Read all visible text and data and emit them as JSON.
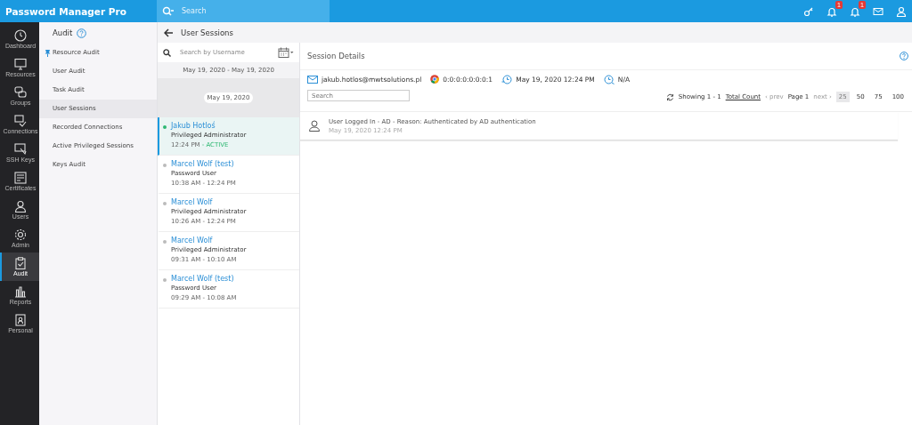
{
  "app": {
    "logo": "Password Manager Pro",
    "search_placeholder": "Search",
    "header_icons": [
      {
        "kind": "key"
      },
      {
        "kind": "bell-star",
        "badge": "1"
      },
      {
        "kind": "bell",
        "badge": "1"
      },
      {
        "kind": "mail"
      },
      {
        "kind": "user"
      }
    ]
  },
  "rail": [
    {
      "label": "Dashboard",
      "selected": false
    },
    {
      "label": "Resources",
      "selected": false
    },
    {
      "label": "Groups",
      "selected": false
    },
    {
      "label": "Connections",
      "selected": false
    },
    {
      "label": "SSH Keys",
      "selected": false
    },
    {
      "label": "Certificates",
      "selected": false
    },
    {
      "label": "Users",
      "selected": false
    },
    {
      "label": "Admin",
      "selected": false
    },
    {
      "label": "Audit",
      "selected": true
    },
    {
      "label": "Reports",
      "selected": false
    },
    {
      "label": "Personal",
      "selected": false
    }
  ],
  "audit_menu": {
    "title": "Audit",
    "items": [
      {
        "label": "Resource Audit",
        "pinned": true,
        "selected": false
      },
      {
        "label": "User Audit",
        "pinned": false,
        "selected": false
      },
      {
        "label": "Task Audit",
        "pinned": false,
        "selected": false
      },
      {
        "label": "User Sessions",
        "pinned": false,
        "selected": true
      },
      {
        "label": "Recorded Connections",
        "pinned": false,
        "selected": false
      },
      {
        "label": "Active Privileged Sessions",
        "pinned": false,
        "selected": false
      },
      {
        "label": "Keys Audit",
        "pinned": false,
        "selected": false
      }
    ]
  },
  "page_title": "User Sessions",
  "sessions": {
    "search_placeholder": "Search by Username",
    "date_range": "May 19, 2020 - May 19, 2020",
    "group_date": "May 19, 2020",
    "items": [
      {
        "name": "Jakub Hotloś",
        "role": "Privileged Administrator",
        "time": "12:24 PM",
        "status": "- ACTIVE",
        "active": true,
        "selected": true
      },
      {
        "name": "Marcel Wolf (test)",
        "role": "Password User",
        "time": "10:38 AM - 12:24 PM",
        "active": false,
        "selected": false
      },
      {
        "name": "Marcel Wolf",
        "role": "Privileged Administrator",
        "time": "10:26 AM - 12:24 PM",
        "active": false,
        "selected": false
      },
      {
        "name": "Marcel Wolf",
        "role": "Privileged Administrator",
        "time": "09:31 AM - 10:10 AM",
        "active": false,
        "selected": false
      },
      {
        "name": "Marcel Wolf (test)",
        "role": "Password User",
        "time": "09:29 AM - 10:08 AM",
        "active": false,
        "selected": false
      }
    ]
  },
  "details": {
    "title": "Session Details",
    "email": "jakub.hotlos@mwtsolutions.pl",
    "ip": "0:0:0:0:0:0:0:1",
    "login_time": "May 19, 2020 12:24 PM",
    "logout_time": "N/A",
    "search_placeholder": "Search",
    "showing": "Showing 1 - 1",
    "total_count": "Total Count",
    "prev": "‹ prev",
    "page": "Page 1",
    "next": "next ›",
    "page_sizes": [
      {
        "label": "25",
        "selected": true
      },
      {
        "label": "50",
        "selected": false
      },
      {
        "label": "75",
        "selected": false
      },
      {
        "label": "100",
        "selected": false
      }
    ],
    "events": [
      {
        "text": "User Logged In - AD - Reason: Authenticated by AD authentication",
        "time": "May 19, 2020 12:24 PM"
      }
    ]
  }
}
